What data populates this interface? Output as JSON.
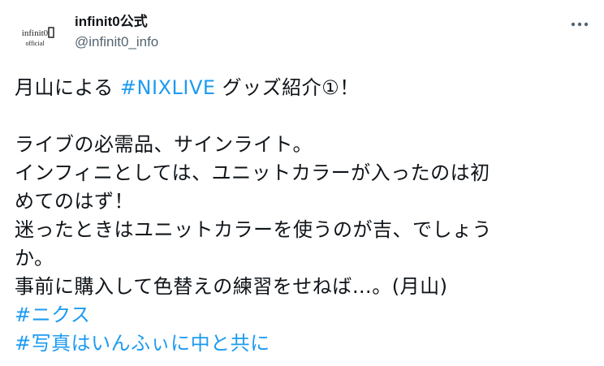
{
  "author": {
    "display_name": "infinit0公式",
    "handle": "@infinit0_info",
    "avatar_text_top": "infinit0",
    "avatar_text_bottom": "official"
  },
  "tweet": {
    "line1_pre": "月山による ",
    "line1_tag": "#NIXLIVE",
    "line1_post": " グッズ紹介①！",
    "line3": "ライブの必需品、サインライト。",
    "line4": "インフィニとしては、ユニットカラーが入ったのは初",
    "line5": "めてのはず！",
    "line6": "迷ったときはユニットカラーを使うのが吉、でしょう",
    "line7": "か。",
    "line8": "事前に購入して色替えの練習をせねば…。(月山)",
    "hashtag2": "#ニクス",
    "hashtag3": "#写真はいんふぃに中と共に"
  },
  "colors": {
    "text": "#0f1419",
    "secondary": "#536471",
    "link": "#1d9bf0"
  },
  "icons": {
    "more": "more-horizontal-icon"
  }
}
